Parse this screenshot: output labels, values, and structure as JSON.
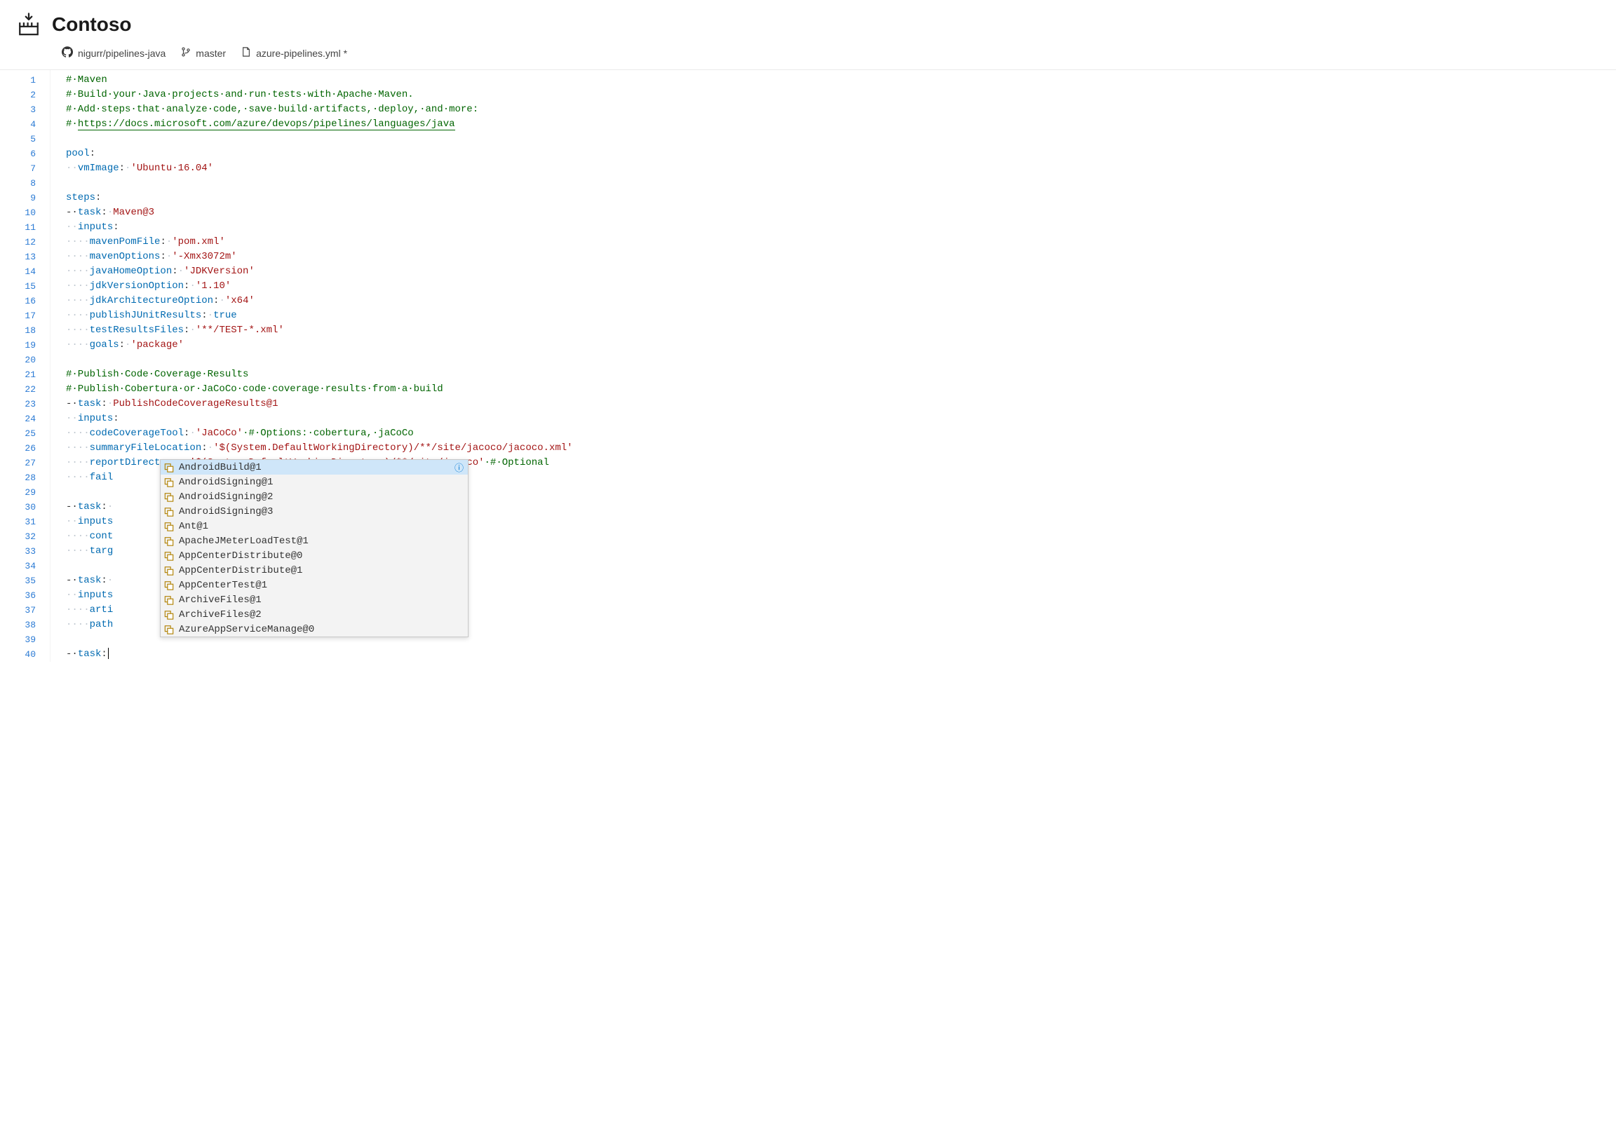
{
  "header": {
    "title": "Contoso"
  },
  "breadcrumb": {
    "repo": "nigurr/pipelines-java",
    "branch": "master",
    "file": "azure-pipelines.yml *"
  },
  "editor": {
    "line_count": 40
  },
  "code": {
    "l1_comment": "#·Maven",
    "l2_comment": "#·Build·your·Java·projects·and·run·tests·with·Apache·Maven.",
    "l3_comment": "#·Add·steps·that·analyze·code,·save·build·artifacts,·deploy,·and·more:",
    "l4_prefix": "#·",
    "l4_url": "https://docs.microsoft.com/azure/devops/pipelines/languages/java",
    "l6_key": "pool",
    "l7_pad": "··",
    "l7_key": "vmImage",
    "l7_val": "'Ubuntu·16.04'",
    "l9_key": "steps",
    "l10_dash": "-·",
    "l10_key": "task",
    "l10_val": "Maven@3",
    "l11_pad": "··",
    "l11_key": "inputs",
    "l12_pad": "····",
    "l12_key": "mavenPomFile",
    "l12_val": "'pom.xml'",
    "l13_key": "mavenOptions",
    "l13_val": "'-Xmx3072m'",
    "l14_key": "javaHomeOption",
    "l14_val": "'JDKVersion'",
    "l15_key": "jdkVersionOption",
    "l15_val": "'1.10'",
    "l16_key": "jdkArchitectureOption",
    "l16_val": "'x64'",
    "l17_key": "publishJUnitResults",
    "l17_val": "true",
    "l18_key": "testResultsFiles",
    "l18_val": "'**/TEST-*.xml'",
    "l19_key": "goals",
    "l19_val": "'package'",
    "l21_comment": "#·Publish·Code·Coverage·Results",
    "l22_comment": "#·Publish·Cobertura·or·JaCoCo·code·coverage·results·from·a·build",
    "l23_key": "task",
    "l23_val": "PublishCodeCoverageResults@1",
    "l24_key": "inputs",
    "l25_key": "codeCoverageTool",
    "l25_val": "'JaCoCo'",
    "l25_comment": "·#·Options:·cobertura,·jaCoCo",
    "l26_key": "summaryFileLocation",
    "l26_val": "'$(System.DefaultWorkingDirectory)/**/site/jacoco/jacoco.xml'",
    "l27_key": "reportDirectory",
    "l27_val": "'$(System.DefaultWorkingDirectory)/**/site/jacoco'",
    "l27_comment": "·#·Optional",
    "l28_text": "fail",
    "l30_key": "task",
    "l31_key": "inputs",
    "l32_key": "cont",
    "l33_key": "targ",
    "l35_key": "task",
    "l36_key": "inputs",
    "l37_key": "arti",
    "l38_key": "path",
    "l40_key": "task"
  },
  "suggestions": [
    {
      "label": "AndroidBuild@1",
      "selected": true
    },
    {
      "label": "AndroidSigning@1",
      "selected": false
    },
    {
      "label": "AndroidSigning@2",
      "selected": false
    },
    {
      "label": "AndroidSigning@3",
      "selected": false
    },
    {
      "label": "Ant@1",
      "selected": false
    },
    {
      "label": "ApacheJMeterLoadTest@1",
      "selected": false
    },
    {
      "label": "AppCenterDistribute@0",
      "selected": false
    },
    {
      "label": "AppCenterDistribute@1",
      "selected": false
    },
    {
      "label": "AppCenterTest@1",
      "selected": false
    },
    {
      "label": "ArchiveFiles@1",
      "selected": false
    },
    {
      "label": "ArchiveFiles@2",
      "selected": false
    },
    {
      "label": "AzureAppServiceManage@0",
      "selected": false
    }
  ]
}
